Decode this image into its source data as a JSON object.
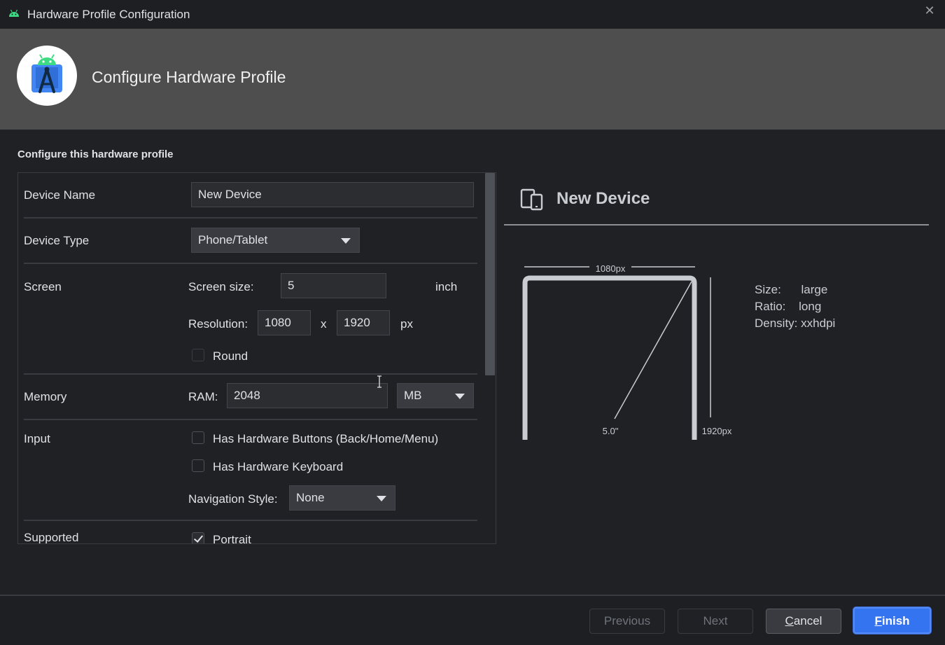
{
  "window": {
    "title": "Hardware Profile Configuration"
  },
  "header": {
    "title": "Configure Hardware Profile"
  },
  "section_title": "Configure this hardware profile",
  "form": {
    "device_name": {
      "label": "Device Name",
      "value": "New Device"
    },
    "device_type": {
      "label": "Device Type",
      "value": "Phone/Tablet"
    },
    "screen": {
      "label": "Screen",
      "size_label": "Screen size:",
      "size_value": "5",
      "size_unit": "inch",
      "resolution_label": "Resolution:",
      "res_x": "1080",
      "res_sep": "x",
      "res_y": "1920",
      "res_unit": "px",
      "round_label": "Round",
      "round_checked": false
    },
    "memory": {
      "label": "Memory",
      "ram_label": "RAM:",
      "ram_value": "2048",
      "ram_unit": "MB"
    },
    "input": {
      "label": "Input",
      "hw_buttons_label": "Has Hardware Buttons (Back/Home/Menu)",
      "hw_buttons_checked": false,
      "hw_keyboard_label": "Has Hardware Keyboard",
      "hw_keyboard_checked": false,
      "nav_style_label": "Navigation Style:",
      "nav_style_value": "None"
    },
    "supported": {
      "label": "Supported",
      "portrait_label": "Portrait",
      "portrait_checked": true
    }
  },
  "preview": {
    "name": "New Device",
    "width_label": "1080px",
    "height_label": "1920px",
    "diagonal_label": "5.0\"",
    "size_key": "Size:",
    "size_val": "large",
    "ratio_key": "Ratio:",
    "ratio_val": "long",
    "density_key": "Density:",
    "density_val": "xxhdpi"
  },
  "buttons": {
    "previous": "Previous",
    "next": "Next",
    "cancel_first": "C",
    "cancel_rest": "ancel",
    "finish_first": "F",
    "finish_rest": "inish"
  },
  "colors": {
    "accent": "#3574f0",
    "background": "#1f2125",
    "header": "#4e4e4e"
  }
}
